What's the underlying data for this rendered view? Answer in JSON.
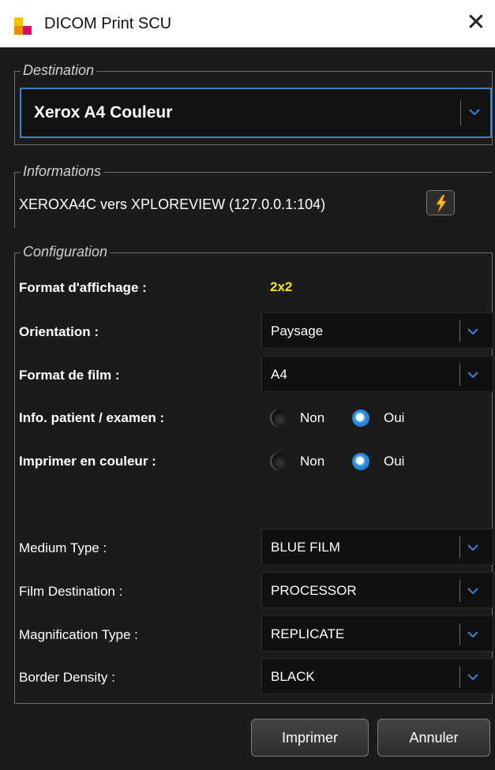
{
  "window": {
    "title": "DICOM Print SCU",
    "close_glyph": "✕"
  },
  "destination": {
    "legend": "Destination",
    "selected": "Xerox A4 Couleur"
  },
  "informations": {
    "legend": "Informations",
    "text": "XEROXA4C vers XPLOREVIEW (127.0.0.1:104)",
    "action_icon": "lightning-icon"
  },
  "configuration": {
    "legend": "Configuration",
    "format_label": "Format d'affichage :",
    "format_value": "2x2",
    "orientation_label": "Orientation :",
    "orientation_value": "Paysage",
    "film_format_label": "Format de film :",
    "film_format_value": "A4",
    "patient_info_label": "Info. patient / examen :",
    "color_print_label": "Imprimer en couleur :",
    "radio_no": "Non",
    "radio_yes": "Oui",
    "patient_info_selected": "Oui",
    "color_print_selected": "Oui",
    "medium_type_label": "Medium Type :",
    "medium_type_value": "BLUE FILM",
    "film_destination_label": "Film Destination :",
    "film_destination_value": "PROCESSOR",
    "magnification_label": "Magnification Type :",
    "magnification_value": "REPLICATE",
    "border_density_label": "Border Density :",
    "border_density_value": "BLACK"
  },
  "buttons": {
    "print": "Imprimer",
    "cancel": "Annuler"
  },
  "colors": {
    "accent": "#2f86d6",
    "format_value": "#f2e600",
    "background": "#1b1b1b"
  }
}
